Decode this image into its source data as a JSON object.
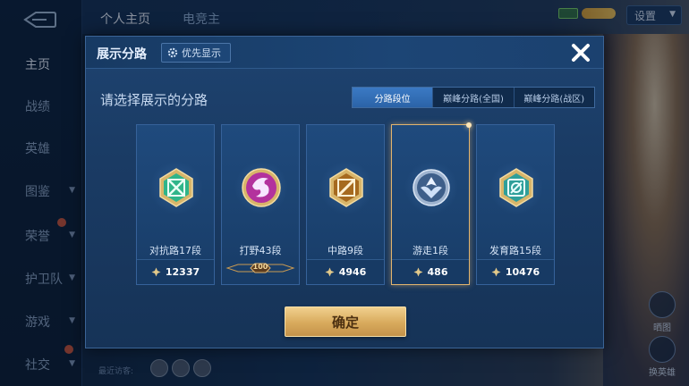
{
  "nav": {
    "items": [
      {
        "label": "主页",
        "chevron": false,
        "dot": false
      },
      {
        "label": "战绩",
        "chevron": false,
        "dot": false
      },
      {
        "label": "英雄",
        "chevron": false,
        "dot": false
      },
      {
        "label": "图鉴",
        "chevron": true,
        "dot": false
      },
      {
        "label": "荣誉",
        "chevron": true,
        "dot": true
      },
      {
        "label": "护卫队",
        "chevron": true,
        "dot": false
      },
      {
        "label": "游戏",
        "chevron": true,
        "dot": false
      },
      {
        "label": "社交",
        "chevron": true,
        "dot": true
      }
    ]
  },
  "top": {
    "tabs": [
      "个人主页",
      "电竞主"
    ],
    "settings_label": "设置"
  },
  "footer": {
    "recent_label": "最近访客:"
  },
  "side": {
    "btn1": "晒图",
    "btn2": "换英雄"
  },
  "dialog": {
    "title": "展示分路",
    "priority_label": "优先显示",
    "subtitle": "请选择展示的分路",
    "segments": [
      "分路段位",
      "巅峰分路(全国)",
      "巅峰分路(战区)"
    ],
    "active_segment": 0,
    "lanes": [
      {
        "label": "对抗路17段",
        "value": "12337",
        "emblem": "clash-lane-icon",
        "color": "#2fb58a"
      },
      {
        "label": "打野43段",
        "value": "100",
        "emblem": "jungle-icon",
        "color": "#b3329d",
        "badge": "100"
      },
      {
        "label": "中路9段",
        "value": "4946",
        "emblem": "mid-lane-icon",
        "color": "#c98a2d"
      },
      {
        "label": "游走1段",
        "value": "486",
        "emblem": "roam-icon",
        "color": "#5d7fa8",
        "selected": true
      },
      {
        "label": "发育路15段",
        "value": "10476",
        "emblem": "farm-lane-icon",
        "color": "#2f9f9a"
      }
    ],
    "confirm_label": "确定"
  }
}
